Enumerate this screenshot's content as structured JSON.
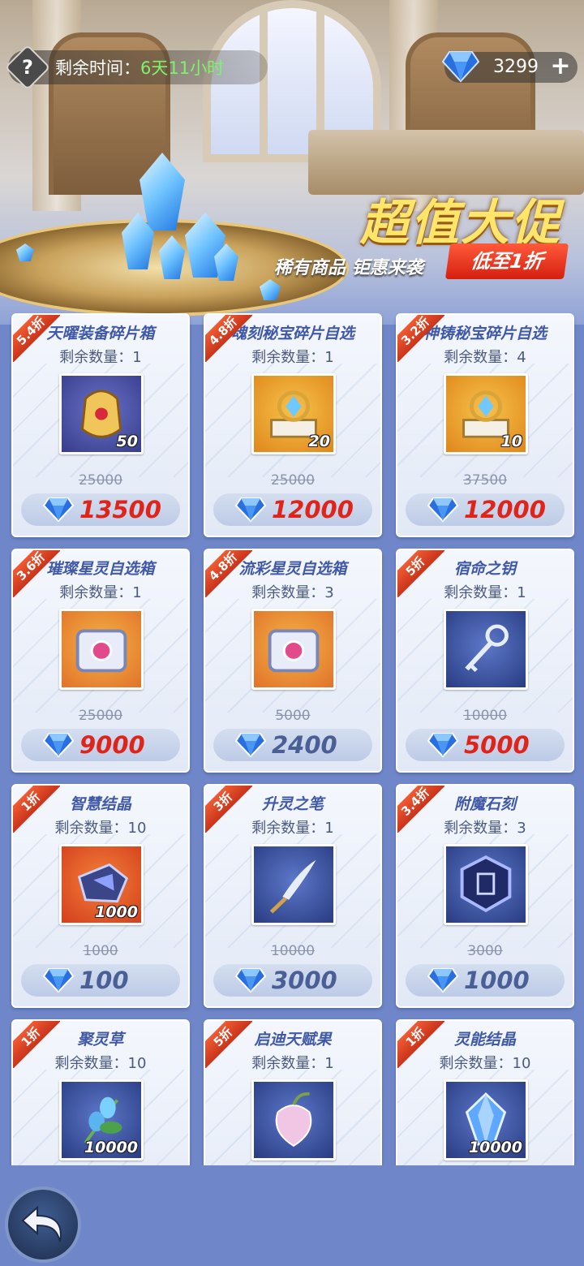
{
  "header": {
    "help_icon": "question-icon",
    "timer_label": "剩余时间：",
    "timer_value": "6天11小时",
    "currency_icon": "diamond-icon",
    "currency_value": "3299",
    "add_icon": "plus-icon"
  },
  "banner": {
    "title": "超值大促",
    "subtitle": "稀有商品 钜惠来袭",
    "badge": "低至1折"
  },
  "colors": {
    "discount_red": "#e0241a",
    "price_gray": "#4b5f97",
    "timer_green": "#7cf36b",
    "tag_red": "#d9412a"
  },
  "stock_label": "剩余数量：",
  "items": [
    {
      "name": "天曜装备碎片箱",
      "discount": "5.4折",
      "stock": "1",
      "qty": "50",
      "old_price": "25000",
      "price": "13500",
      "price_style": "red",
      "icon": "armor-icon"
    },
    {
      "name": "魂刻秘宝碎片自选",
      "discount": "4.8折",
      "stock": "1",
      "qty": "20",
      "old_price": "25000",
      "price": "12000",
      "price_style": "red",
      "icon": "relic-orb-icon"
    },
    {
      "name": "神铸秘宝碎片自选",
      "discount": "3.2折",
      "stock": "4",
      "qty": "10",
      "old_price": "37500",
      "price": "12000",
      "price_style": "red",
      "icon": "relic-orb-icon"
    },
    {
      "name": "璀璨星灵自选箱",
      "discount": "3.6折",
      "stock": "1",
      "qty": "",
      "old_price": "25000",
      "price": "9000",
      "price_style": "red",
      "icon": "chest-icon"
    },
    {
      "name": "流彩星灵自选箱",
      "discount": "4.8折",
      "stock": "3",
      "qty": "",
      "old_price": "5000",
      "price": "2400",
      "price_style": "gray",
      "icon": "chest-icon"
    },
    {
      "name": "宿命之钥",
      "discount": "5折",
      "stock": "1",
      "qty": "",
      "old_price": "10000",
      "price": "5000",
      "price_style": "red",
      "icon": "key-icon"
    },
    {
      "name": "智慧结晶",
      "discount": "1折",
      "stock": "10",
      "qty": "1000",
      "old_price": "1000",
      "price": "100",
      "price_style": "gray",
      "icon": "crystal-icon"
    },
    {
      "name": "升灵之笔",
      "discount": "3折",
      "stock": "1",
      "qty": "",
      "old_price": "10000",
      "price": "3000",
      "price_style": "gray",
      "icon": "quill-icon"
    },
    {
      "name": "附魔石刻",
      "discount": "3.4折",
      "stock": "3",
      "qty": "",
      "old_price": "3000",
      "price": "1000",
      "price_style": "gray",
      "icon": "rune-stone-icon"
    },
    {
      "name": "聚灵草",
      "discount": "1折",
      "stock": "10",
      "qty": "10000",
      "old_price": "",
      "price": "",
      "price_style": "gray",
      "icon": "herb-icon"
    },
    {
      "name": "启迪天赋果",
      "discount": "5折",
      "stock": "1",
      "qty": "",
      "old_price": "",
      "price": "",
      "price_style": "gray",
      "icon": "fruit-icon"
    },
    {
      "name": "灵能结晶",
      "discount": "1折",
      "stock": "10",
      "qty": "10000",
      "old_price": "",
      "price": "",
      "price_style": "gray",
      "icon": "blue-crystal-icon"
    }
  ],
  "back_icon": "back-arrow-icon"
}
